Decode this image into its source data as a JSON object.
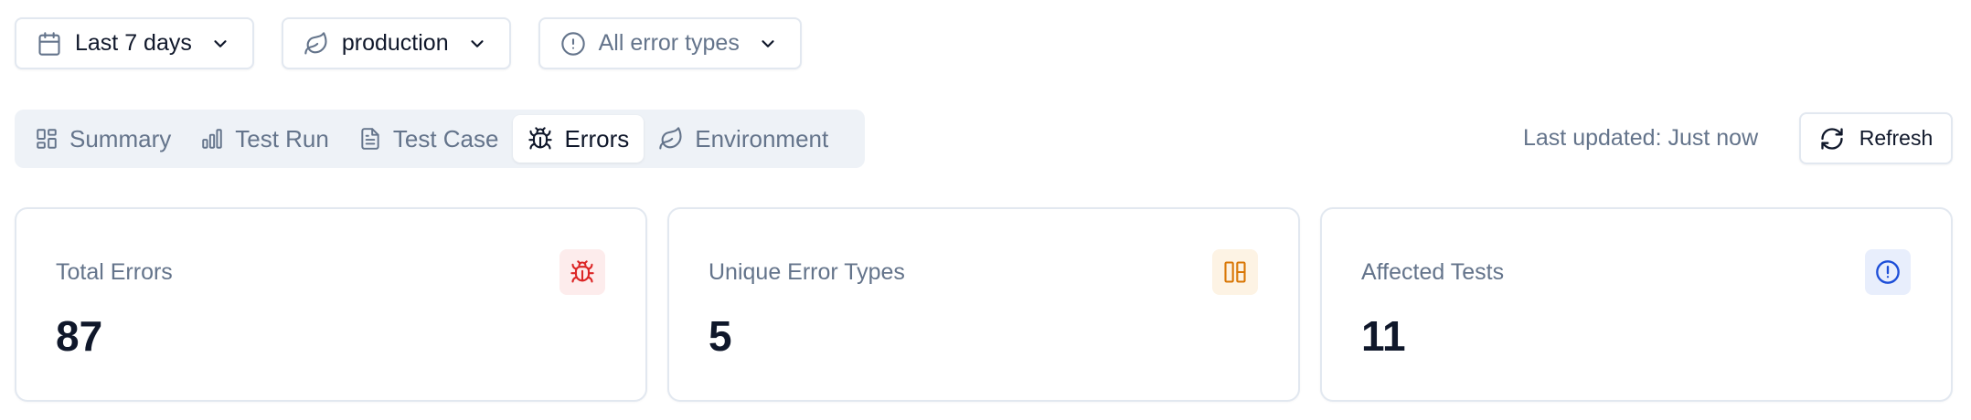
{
  "filters": {
    "date_range": "Last 7 days",
    "environment": "production",
    "error_type": "All error types"
  },
  "tabs": [
    {
      "label": "Summary",
      "icon": "summary-icon"
    },
    {
      "label": "Test Run",
      "icon": "bar-chart-icon"
    },
    {
      "label": "Test Case",
      "icon": "file-text-icon"
    },
    {
      "label": "Errors",
      "icon": "bug-icon",
      "active": true
    },
    {
      "label": "Environment",
      "icon": "leaf-icon"
    }
  ],
  "status": {
    "last_updated": "Last updated: Just now",
    "refresh_label": "Refresh"
  },
  "stats": [
    {
      "label": "Total Errors",
      "value": "87",
      "icon": "bug-icon",
      "color": "#dc2626"
    },
    {
      "label": "Unique Error Types",
      "value": "5",
      "icon": "columns-icon",
      "color": "#d97706"
    },
    {
      "label": "Affected Tests",
      "value": "11",
      "icon": "alert-circle-icon",
      "color": "#1d4ed8"
    }
  ]
}
